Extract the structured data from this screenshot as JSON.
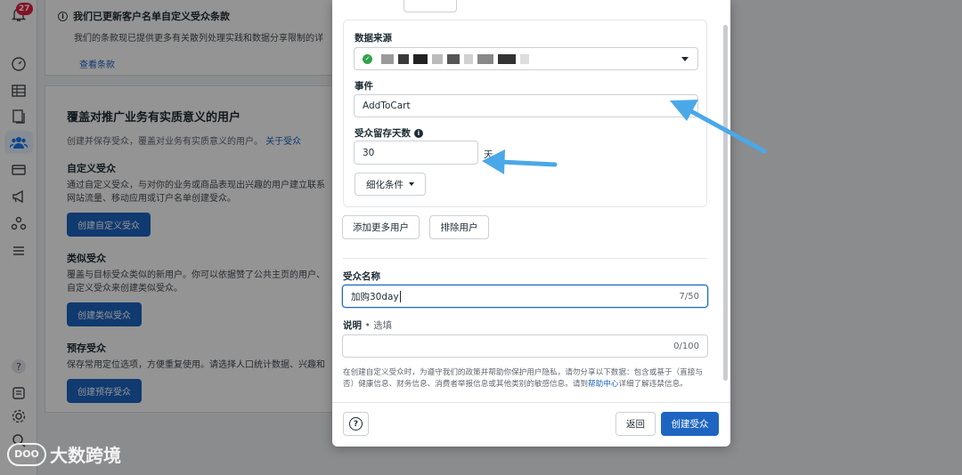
{
  "rail": {
    "notification_count": "27"
  },
  "notice": {
    "title": "我们已更新客户名单自定义受众条款",
    "body": "我们的条款现已提供更多有关散列处理实践和数据分享限制的详",
    "link": "查看条款"
  },
  "audiences_page": {
    "heading": "覆盖对推广业务有实质意义的用户",
    "subtitle": "创建并保存受众，覆盖对业务有实质意义的用户。",
    "subtitle_link": "关于受众",
    "custom": {
      "title": "自定义受众",
      "desc": "通过自定义受众，与对你的业务或商品表现出兴趣的用户建立联系",
      "desc2": "网站流量、移动应用或订户名单创建受众。",
      "button": "创建自定义受众"
    },
    "lookalike": {
      "title": "类似受众",
      "desc": "覆盖与目标受众类似的新用户。你可以依据赞了公共主页的用户、",
      "desc2": "自定义受众来创建类似受众。",
      "button": "创建类似受众"
    },
    "saved": {
      "title": "预存受众",
      "desc": "保存常用定位选项，方便重复使用。请选择人口统计数据、兴趣和",
      "button": "创建预存受众"
    }
  },
  "modal": {
    "source_label": "数据来源",
    "event_label": "事件",
    "event_value": "AddToCart",
    "retention_label": "受众留存天数",
    "retention_value": "30",
    "retention_unit": "天",
    "refine_button": "细化条件",
    "add_more_button": "添加更多用户",
    "exclude_button": "排除用户",
    "name_label": "受众名称",
    "name_value": "加购30day",
    "name_counter": "7/50",
    "desc_label": "说明",
    "desc_optional": "• 选填",
    "desc_value": "",
    "desc_counter": "0/100",
    "disclaimer_pre": "在创建自定义受众时，为遵守我们的政策并帮助你保护用户隐私，请勿分享以下数据：包含或基于（直接与否）健康信息、财务信息、消费者举报信息或其他类别的敏感信息。请到",
    "disclaimer_link": "帮助中心",
    "disclaimer_post": "详细了解违禁信息。",
    "help_glyph": "?",
    "back_button": "返回",
    "create_button": "创建受众"
  },
  "watermark": {
    "logo_text": "DOO",
    "text": "大数跨境"
  },
  "colors": {
    "primary": "#1d65c1",
    "annotation_arrow": "#4aa8e8",
    "success": "#31a24c",
    "badge": "#e41e3f"
  }
}
